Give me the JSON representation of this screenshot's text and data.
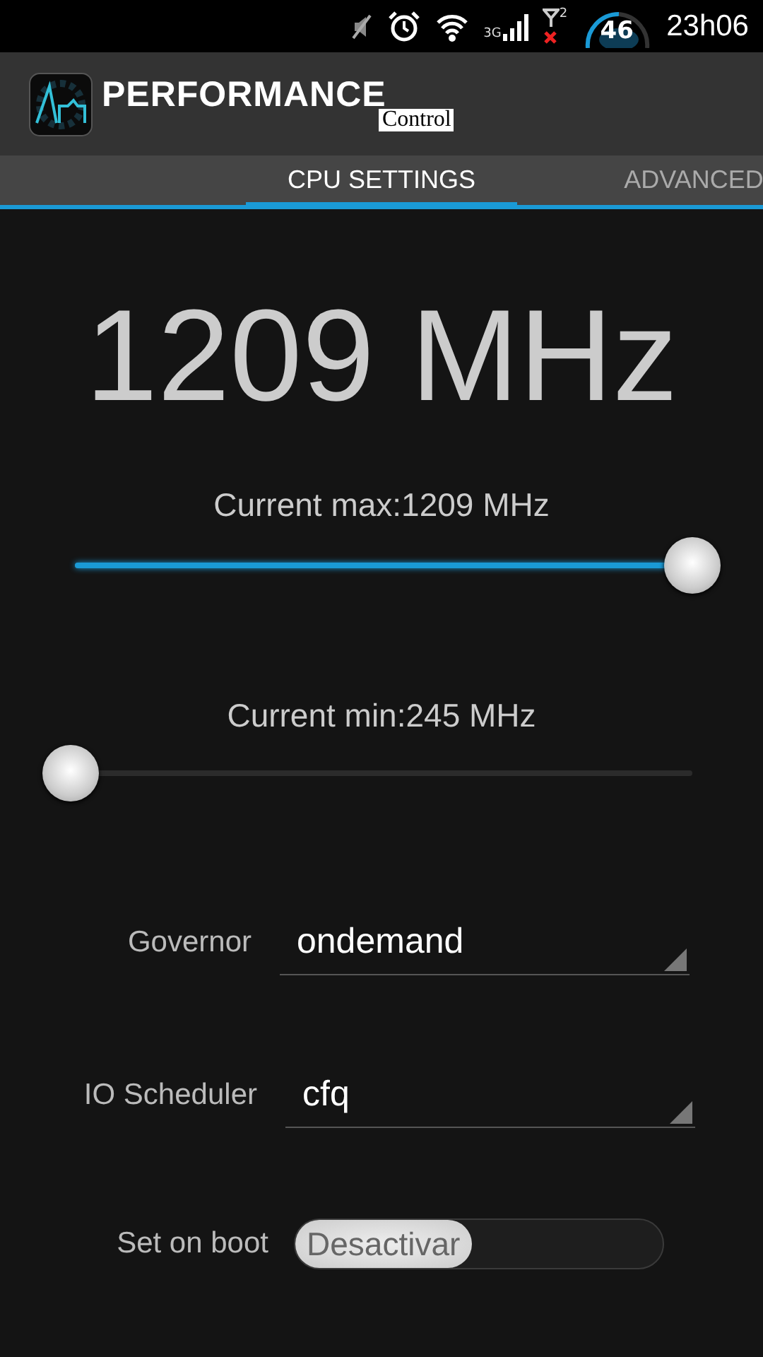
{
  "status_bar": {
    "network": "3G",
    "sim": "2",
    "battery": "46",
    "time": "23h06"
  },
  "app": {
    "title": "PERFORMANCE",
    "subtitle": "Control"
  },
  "tabs": [
    {
      "label": "CPU SETTINGS",
      "selected": true
    },
    {
      "label": "ADVANCED",
      "selected": false
    }
  ],
  "frequency": "1209 MHz",
  "sliders": [
    {
      "label": "Current max:1209 MHz",
      "level": 1.0
    },
    {
      "label": "Current min:245 MHz",
      "level": 0.0
    }
  ],
  "dropdowns": [
    {
      "label": "Governor",
      "value": "ondemand"
    },
    {
      "label": "IO Scheduler",
      "value": "cfq"
    }
  ],
  "set_on_boot": {
    "label": "Set on boot",
    "state_text": "Desactivar",
    "on": false
  }
}
